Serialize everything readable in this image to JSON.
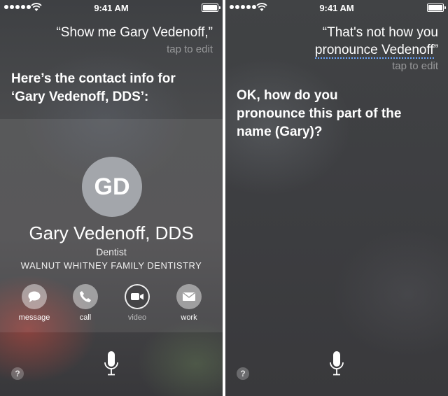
{
  "status_bar": {
    "time": "9:41 AM"
  },
  "left": {
    "query": "“Show me Gary Vedenoff,”",
    "tap_to_edit": "tap to edit",
    "response_line1": "Here’s the contact info for",
    "response_line2": "‘Gary Vedenoff, DDS’:",
    "contact": {
      "initials": "GD",
      "name": "Gary Vedenoff, DDS",
      "title": "Dentist",
      "company": "WALNUT WHITNEY FAMILY DENTISTRY"
    },
    "actions": [
      {
        "label": "message",
        "icon": "message-bubble-icon"
      },
      {
        "label": "call",
        "icon": "phone-icon"
      },
      {
        "label": "video",
        "icon": "video-camera-icon"
      },
      {
        "label": "work",
        "icon": "envelope-icon"
      }
    ]
  },
  "right": {
    "query_line1": "“That's not how you",
    "query_line2_a": "pronounce Vedenoff",
    "query_line2_b": "”",
    "tap_to_edit": "tap to edit",
    "response_line1": "OK, how do you",
    "response_line2": "pronounce this part of the",
    "response_line3": "name (Gary)?"
  },
  "help_label": "?"
}
